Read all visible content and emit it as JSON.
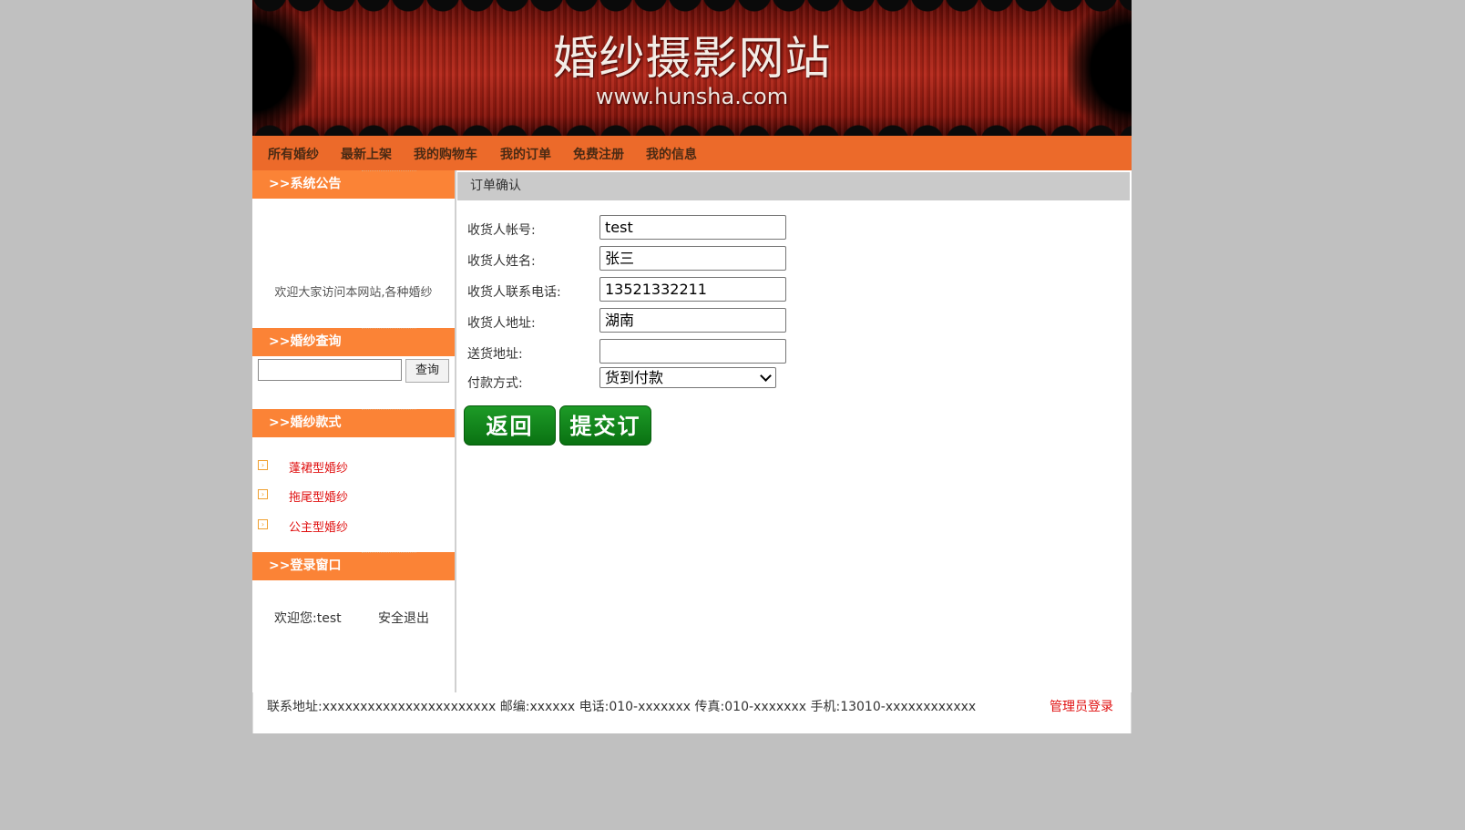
{
  "banner": {
    "title": "婚纱摄影网站",
    "domain": "www.hunsha.com"
  },
  "nav": [
    "所有婚纱",
    "最新上架",
    "我的购物车",
    "我的订单",
    "免费注册",
    "我的信息"
  ],
  "sidebar": {
    "notice_title": ">>系统公告",
    "notice_text": "欢迎大家访问本网站,各种婚纱",
    "search_title": ">>婚纱查询",
    "search_value": "",
    "search_button": "查询",
    "styles_title": ">>婚纱款式",
    "styles": [
      "蓬裙型婚纱",
      "拖尾型婚纱",
      "公主型婚纱"
    ],
    "login_title": ">>登录窗口",
    "welcome": "欢迎您:test",
    "logout": "安全退出"
  },
  "order": {
    "header": "订单确认",
    "fields": [
      {
        "label": "收货人帐号:",
        "value": "test"
      },
      {
        "label": "收货人姓名:",
        "value": "张三"
      },
      {
        "label": "收货人联系电话:",
        "value": "13521332211"
      },
      {
        "label": "收货人地址:",
        "value": "湖南"
      },
      {
        "label": "送货地址:",
        "value": ""
      }
    ],
    "payment_label": "付款方式:",
    "payment_value": "货到付款",
    "back_button": "返回",
    "submit_button": "提交订单"
  },
  "footer": {
    "info": "联系地址:xxxxxxxxxxxxxxxxxxxxxxx    邮编:xxxxxx 电话:010-xxxxxxx    传真:010-xxxxxxx    手机:13010-xxxxxxxxxxxx",
    "admin": "管理员登录"
  },
  "colors": {
    "nav": "#ec6a2a",
    "sidebar_head": "#fb8336",
    "button_green": "#0a7212",
    "link_red": "#e01010"
  }
}
